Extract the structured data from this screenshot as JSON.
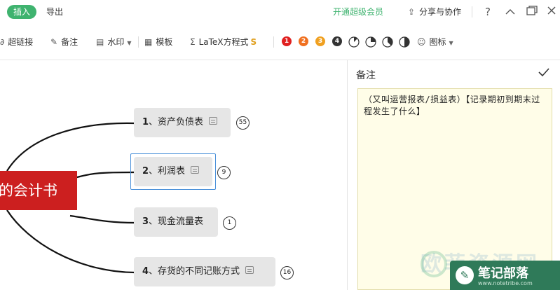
{
  "topbar": {
    "tab_insert": "插入",
    "tab_export": "导出",
    "vip_link": "开通超级会员",
    "share_label": "分享与协作",
    "help_icon": "?",
    "collapse_icon": "^",
    "restore_icon": "window-restore",
    "close_icon": "×"
  },
  "toolbar": {
    "hyperlink": "超链接",
    "note": "备注",
    "watermark": "水印",
    "template": "模板",
    "latex": "LaTeX方程式",
    "latex_badge": "S",
    "icon_menu": "图标",
    "priorities": [
      {
        "label": "1",
        "color": "#e02020"
      },
      {
        "label": "2",
        "color": "#f07020"
      },
      {
        "label": "3",
        "color": "#f0a020"
      },
      {
        "label": "4",
        "color": "#333333"
      }
    ],
    "progress": [
      0.125,
      0.25,
      0.375,
      0.5
    ]
  },
  "canvas": {
    "central_topic": "的会计书",
    "topics": [
      {
        "num": "1",
        "label": "、资产负债表",
        "count": "55"
      },
      {
        "num": "2",
        "label": "、利润表",
        "count": "9"
      },
      {
        "num": "3",
        "label": "、现金流量表",
        "count": "1"
      },
      {
        "num": "4",
        "label": "、存货的不同记账方式",
        "count": "16"
      }
    ]
  },
  "panel": {
    "title": "备注",
    "note_text": "（又叫运营报表/损益表）【记录期初到期末过程发生了什么】"
  },
  "watermark": {
    "bg_text": "欧菲资源网",
    "brand": "笔记部落",
    "url": "www.notetribe.com"
  },
  "colors": {
    "accent_green": "#3fb36f",
    "central_red": "#cc1f1f",
    "selection_blue": "#4a90d9",
    "note_bg": "#fffde8"
  }
}
